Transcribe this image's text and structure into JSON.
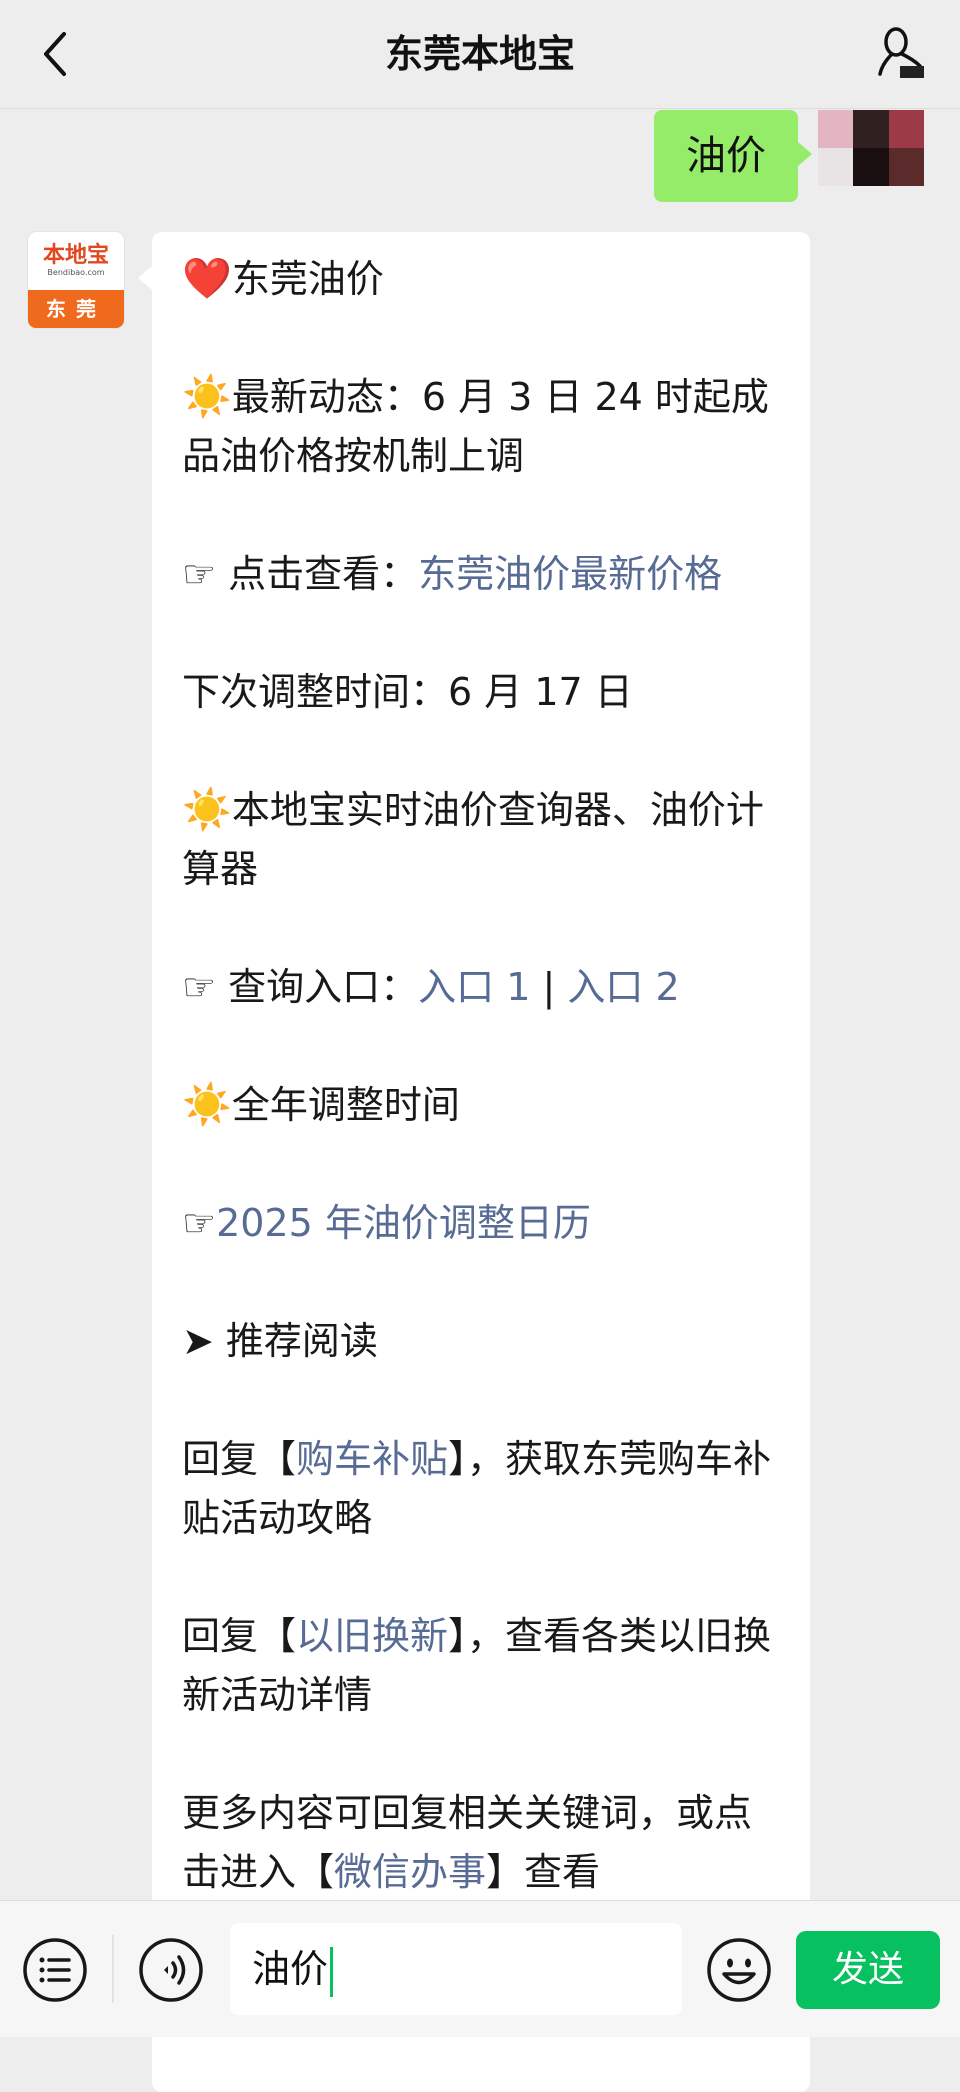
{
  "header": {
    "title": "东莞本地宝",
    "back_icon": "chevron-left-icon",
    "profile_icon": "person-icon"
  },
  "sent_message": {
    "text": "油价"
  },
  "bot": {
    "avatar": {
      "logo_cn": "本地宝",
      "logo_en": "Bendibao.com",
      "city": "东莞"
    }
  },
  "reply": {
    "p1": {
      "emoji": "❤️",
      "text": "东莞油价"
    },
    "p2": {
      "emoji": "☀️",
      "text": "最新动态：6 月 3 日 24 时起成品油价格按机制上调"
    },
    "p3": {
      "emoji": "☞",
      "prefix": " 点击查看：",
      "link": "东莞油价最新价格"
    },
    "p4": {
      "text": "下次调整时间：6 月 17 日"
    },
    "p5": {
      "emoji": "☀️",
      "text": "本地宝实时油价查询器、油价计算器"
    },
    "p6": {
      "emoji": "☞",
      "prefix": " 查询入口：",
      "link1": "入口 1",
      "sep": " | ",
      "link2": "入口 2"
    },
    "p7": {
      "emoji": "☀️",
      "text": "全年调整时间"
    },
    "p8": {
      "emoji": "☞",
      "link": "2025 年油价调整日历"
    },
    "p9": {
      "emoji": "➤",
      "text": " 推荐阅读"
    },
    "p10": {
      "pre": "回复【",
      "link": "购车补贴",
      "post": "】，获取东莞购车补贴活动攻略"
    },
    "p11": {
      "pre": "回复【",
      "link": "以旧换新",
      "post": "】，查看各类以旧换新活动详情"
    },
    "p12": {
      "pre": "更多内容可回复相关关键词，或点击进入【",
      "link": "微信办事",
      "post": "】查看"
    }
  },
  "input": {
    "value": "油价",
    "send_label": "发送",
    "menu_icon": "list-icon",
    "voice_icon": "voice-icon",
    "emoji_icon": "smile-icon"
  },
  "colors": {
    "sent_bubble": "#95ec69",
    "link": "#576b95",
    "send_button": "#07c160",
    "background": "#ededed"
  }
}
